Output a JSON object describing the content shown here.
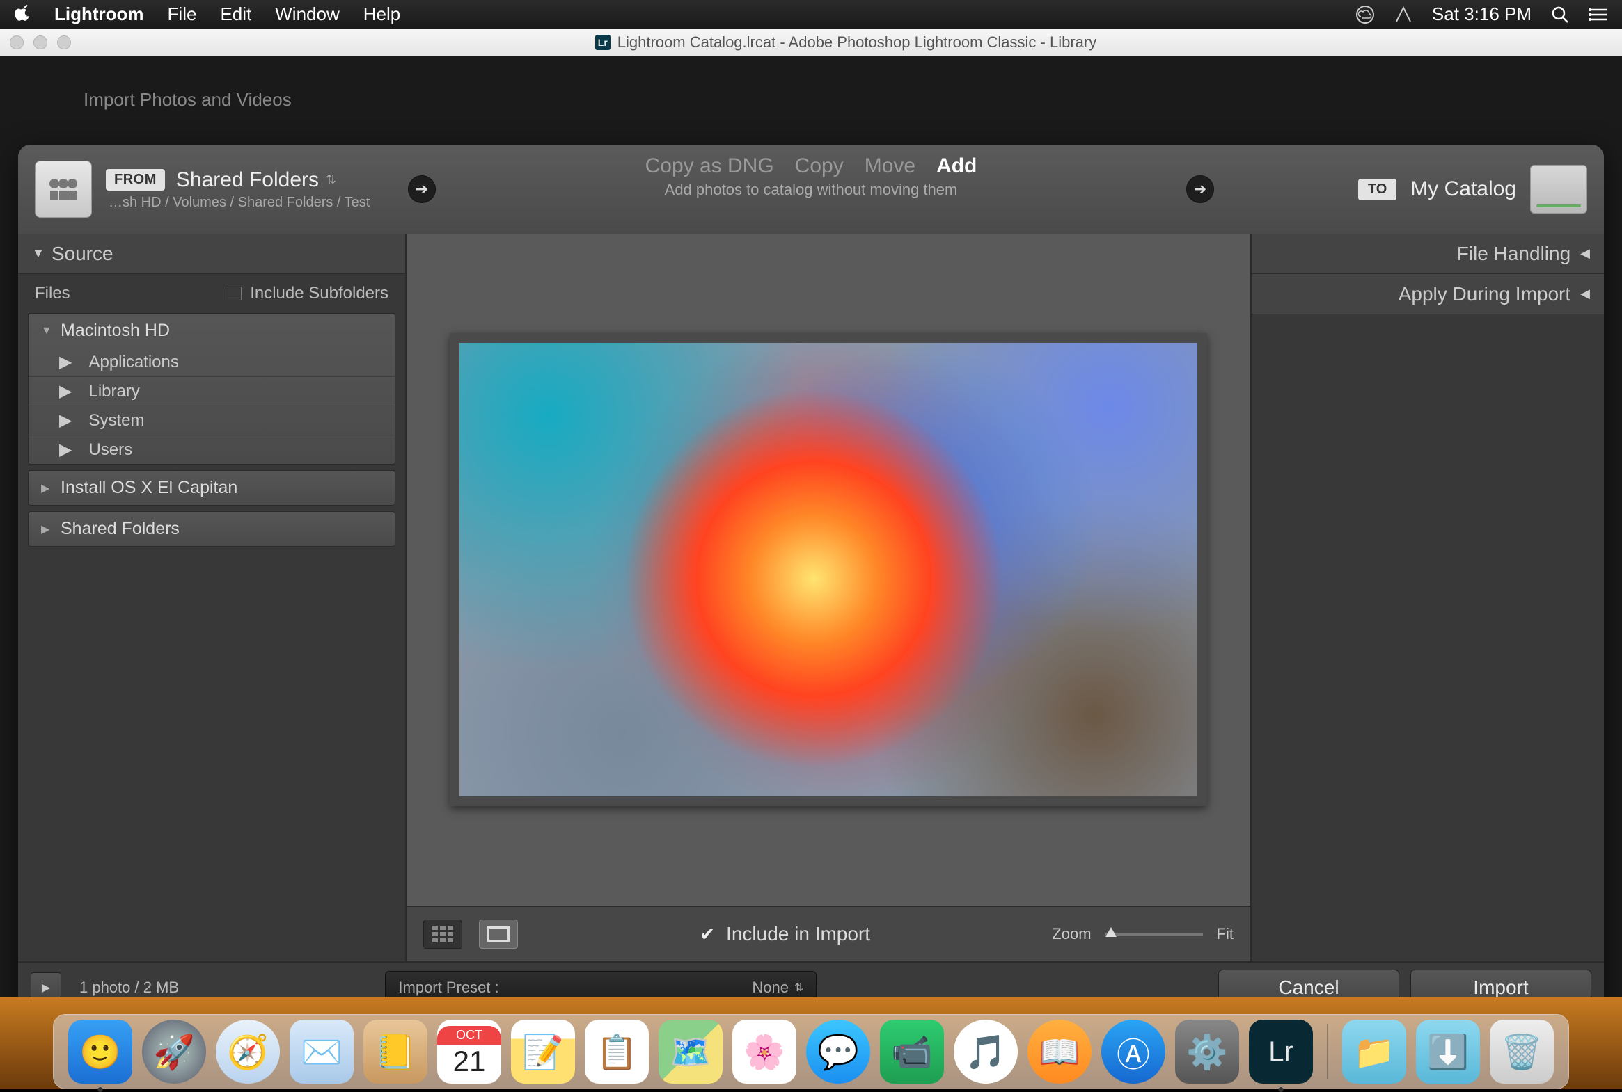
{
  "menubar": {
    "app": "Lightroom",
    "items": [
      "File",
      "Edit",
      "Window",
      "Help"
    ],
    "clock": "Sat 3:16 PM"
  },
  "titlebar": {
    "title": "Lightroom Catalog.lrcat - Adobe Photoshop Lightroom Classic - Library"
  },
  "hidden_window_title": "Import Photos and Videos",
  "dialog": {
    "from_badge": "FROM",
    "from_title": "Shared Folders",
    "from_path": "…sh HD / Volumes / Shared Folders / Test",
    "to_badge": "TO",
    "to_title": "My Catalog",
    "modes": [
      "Copy as DNG",
      "Copy",
      "Move",
      "Add"
    ],
    "active_mode_index": 3,
    "mode_sub": "Add photos to catalog without moving them",
    "left_panel": {
      "title": "Source",
      "files_label": "Files",
      "include_subfolders": "Include Subfolders",
      "tree": [
        {
          "label": "Macintosh HD",
          "expanded": true,
          "children": [
            "Applications",
            "Library",
            "System",
            "Users"
          ]
        },
        {
          "label": "Install OS X El Capitan",
          "expanded": false
        },
        {
          "label": "Shared Folders",
          "expanded": false
        }
      ]
    },
    "right_panel": {
      "rows": [
        "File Handling",
        "Apply During Import"
      ]
    },
    "center_bar": {
      "include_label": "Include in Import",
      "zoom_label": "Zoom",
      "fit_label": "Fit"
    },
    "footer": {
      "count": "1 photo / 2 MB",
      "preset_label": "Import Preset :",
      "preset_value": "None",
      "cancel": "Cancel",
      "import": "Import"
    }
  },
  "dock": {
    "calendar": {
      "month": "OCT",
      "day": "21"
    }
  }
}
